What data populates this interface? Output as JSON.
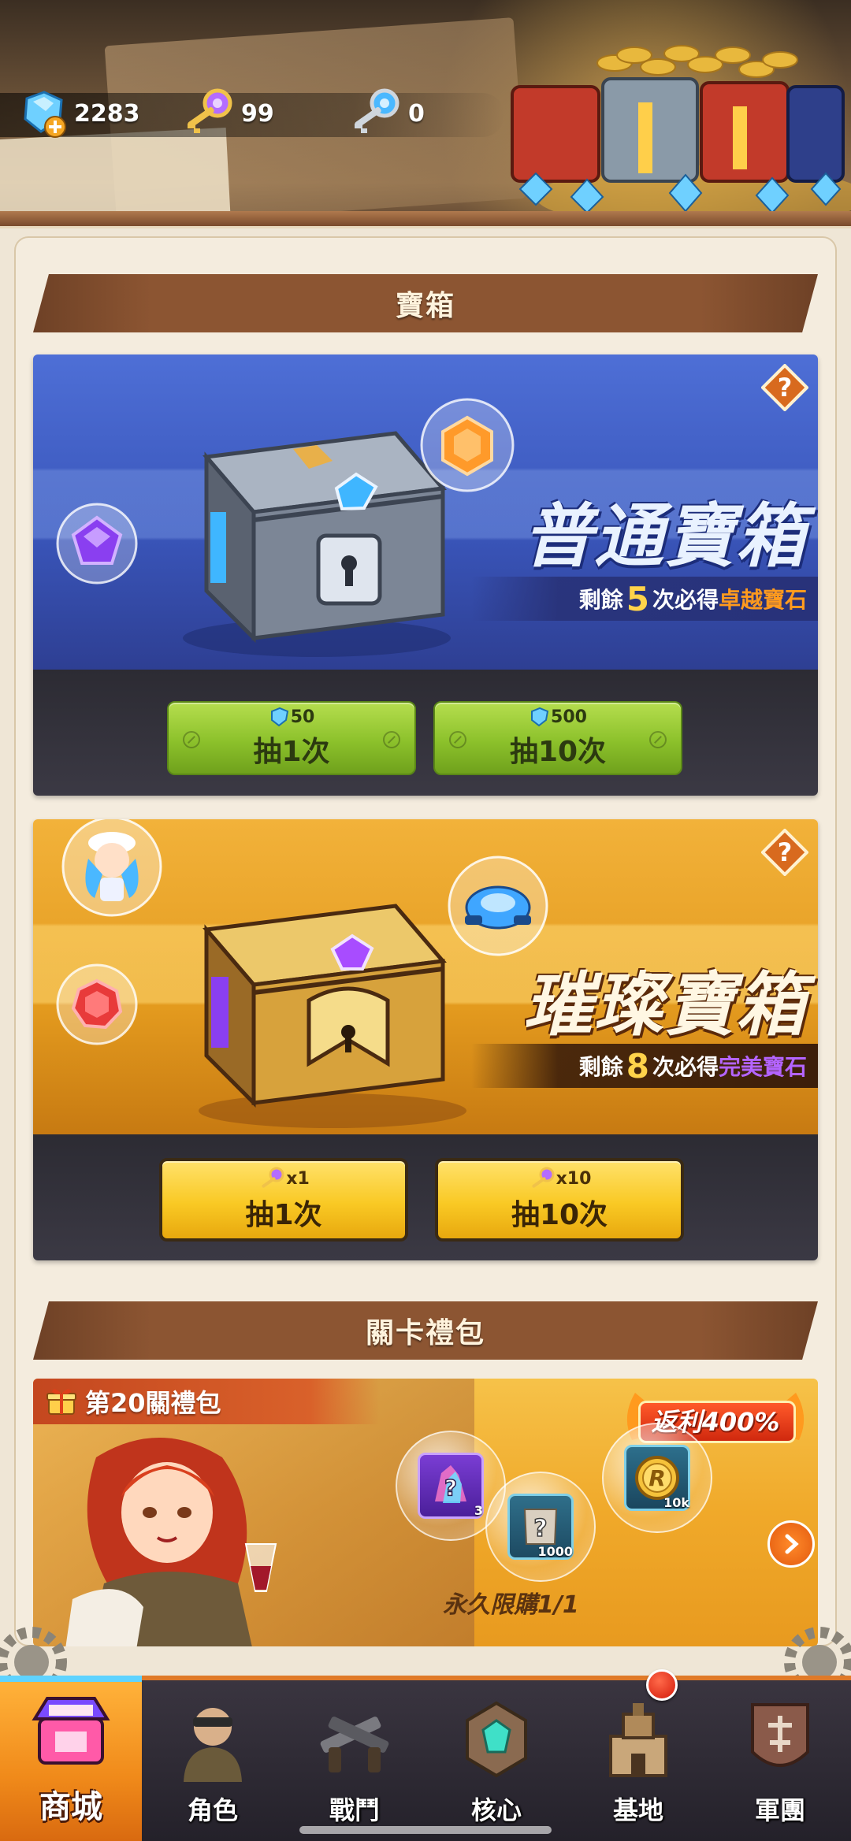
{
  "currencies": [
    {
      "name": "diamond",
      "icon": "diamond-icon",
      "value": "2283"
    },
    {
      "name": "purple-key",
      "icon": "purple-key-icon",
      "value": "99"
    },
    {
      "name": "blue-key",
      "icon": "blue-key-icon",
      "value": "0"
    }
  ],
  "sections": {
    "chests_title": "寶箱",
    "stage_pack_title": "關卡禮包"
  },
  "normal_chest": {
    "name": "普通寶箱",
    "remain_prefix": "剩餘",
    "remain_count": "5",
    "remain_mid": "次必得",
    "remain_reward": "卓越寶石",
    "buttons": [
      {
        "cost": "50",
        "cost_icon": "diamond-icon",
        "label": "抽1次"
      },
      {
        "cost": "500",
        "cost_icon": "diamond-icon",
        "label": "抽10次"
      }
    ]
  },
  "gold_chest": {
    "name": "璀璨寶箱",
    "remain_prefix": "剩餘",
    "remain_count": "8",
    "remain_mid": "次必得",
    "remain_reward": "完美寶石",
    "buttons": [
      {
        "cost": "x1",
        "cost_icon": "purple-key-icon",
        "label": "抽1次"
      },
      {
        "cost": "x10",
        "cost_icon": "purple-key-icon",
        "label": "抽10次"
      }
    ]
  },
  "stage_pack": {
    "header": "第20關禮包",
    "rebate": "返利400%",
    "limit": "永久限購1/1",
    "rewards": [
      {
        "icon": "mystery-crystal-icon",
        "qty": "3"
      },
      {
        "icon": "mystery-scroll-icon",
        "qty": "1000"
      },
      {
        "icon": "gold-coin-icon",
        "qty": "10k"
      }
    ]
  },
  "nav": [
    {
      "label": "商城",
      "icon": "shop-icon",
      "active": true
    },
    {
      "label": "角色",
      "icon": "character-icon",
      "active": false
    },
    {
      "label": "戰鬥",
      "icon": "battle-icon",
      "active": false
    },
    {
      "label": "核心",
      "icon": "core-icon",
      "active": false
    },
    {
      "label": "基地",
      "icon": "base-icon",
      "active": false,
      "badge": true
    },
    {
      "label": "軍團",
      "icon": "legion-icon",
      "active": false
    }
  ],
  "colors": {
    "accent_orange": "#f08a1a",
    "green_button": "#8cc12b",
    "yellow_button": "#f9c924",
    "normal_chest_blue": "#3a56bb",
    "gold_chest_orange": "#e39a1e"
  }
}
